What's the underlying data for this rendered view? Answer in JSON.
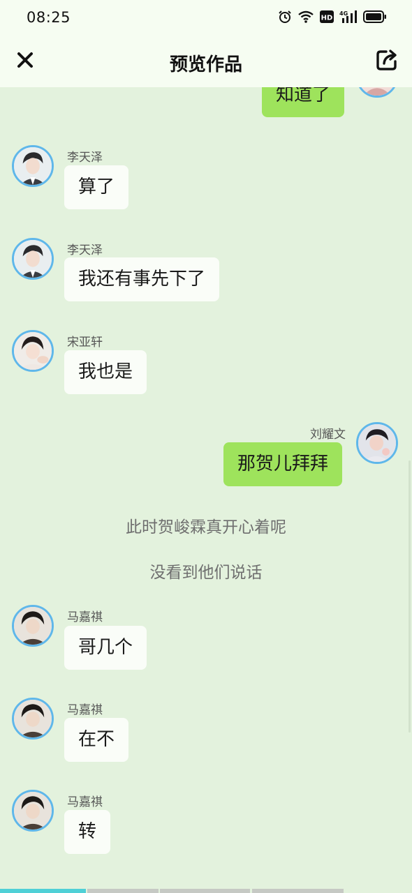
{
  "status_bar": {
    "time": "08:25",
    "icons": [
      "alarm-icon",
      "wifi-icon",
      "hd-icon",
      "4g-signal-icon",
      "battery-icon"
    ],
    "hd_label": "HD",
    "network_label": "4G"
  },
  "header": {
    "title": "预览作品",
    "close_icon": "close-icon",
    "share_icon": "share-icon"
  },
  "messages": [
    {
      "side": "right",
      "sender": "",
      "text": "知道了"
    },
    {
      "side": "left",
      "sender": "李天泽",
      "text": "算了"
    },
    {
      "side": "left",
      "sender": "李天泽",
      "text": "我还有事先下了"
    },
    {
      "side": "left",
      "sender": "宋亚轩",
      "text": "我也是"
    },
    {
      "side": "right",
      "sender": "刘耀文",
      "text": "那贺儿拜拜"
    },
    {
      "side": "center",
      "text": "此时贺峻霖真开心着呢"
    },
    {
      "side": "center",
      "text": "没看到他们说话"
    },
    {
      "side": "left",
      "sender": "马嘉祺",
      "text": "哥几个"
    },
    {
      "side": "left",
      "sender": "马嘉祺",
      "text": "在不"
    },
    {
      "side": "left",
      "sender": "马嘉祺",
      "text": "转"
    }
  ],
  "colors": {
    "background": "#e3f2dd",
    "header_bg": "#f6fdf2",
    "left_bubble": "#fafdf8",
    "right_bubble": "#9ee35c",
    "avatar_border": "#5fb7ea",
    "progress_active": "#4fd0d6"
  },
  "progress": {
    "segments": 4,
    "active_segment": 1,
    "active_fraction": 0.25
  }
}
